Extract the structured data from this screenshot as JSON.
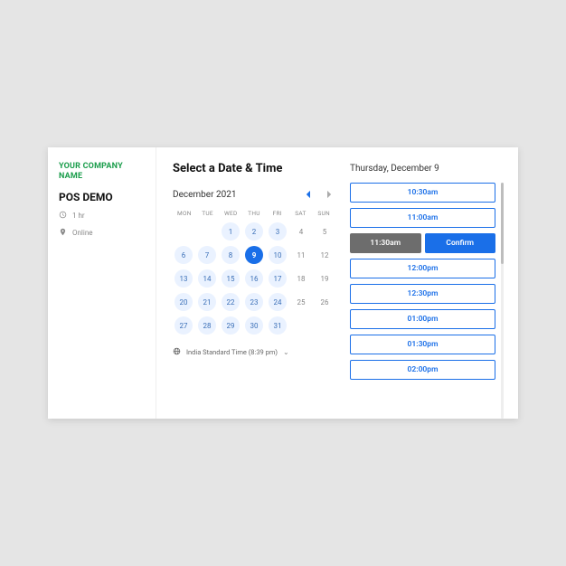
{
  "sidebar": {
    "company_name": "YOUR COMPANY NAME",
    "demo_title": "POS DEMO",
    "duration": "1 hr",
    "location": "Online"
  },
  "main": {
    "title": "Select a Date & Time",
    "month_label": "December 2021",
    "timezone": "India Standard Time (8:39 pm)",
    "selected_date_label": "Thursday, December 9"
  },
  "dow": [
    "MON",
    "TUE",
    "WED",
    "THU",
    "FRI",
    "SAT",
    "SUN"
  ],
  "days": [
    {
      "n": "",
      "t": "empty"
    },
    {
      "n": "",
      "t": "empty"
    },
    {
      "n": "1",
      "t": "avail"
    },
    {
      "n": "2",
      "t": "avail"
    },
    {
      "n": "3",
      "t": "avail"
    },
    {
      "n": "4",
      "t": "plain"
    },
    {
      "n": "5",
      "t": "plain"
    },
    {
      "n": "6",
      "t": "avail"
    },
    {
      "n": "7",
      "t": "avail"
    },
    {
      "n": "8",
      "t": "avail"
    },
    {
      "n": "9",
      "t": "selected"
    },
    {
      "n": "10",
      "t": "avail"
    },
    {
      "n": "11",
      "t": "plain"
    },
    {
      "n": "12",
      "t": "plain"
    },
    {
      "n": "13",
      "t": "avail"
    },
    {
      "n": "14",
      "t": "avail"
    },
    {
      "n": "15",
      "t": "avail"
    },
    {
      "n": "16",
      "t": "avail"
    },
    {
      "n": "17",
      "t": "avail"
    },
    {
      "n": "18",
      "t": "plain"
    },
    {
      "n": "19",
      "t": "plain"
    },
    {
      "n": "20",
      "t": "avail"
    },
    {
      "n": "21",
      "t": "avail"
    },
    {
      "n": "22",
      "t": "avail"
    },
    {
      "n": "23",
      "t": "avail"
    },
    {
      "n": "24",
      "t": "avail"
    },
    {
      "n": "25",
      "t": "plain"
    },
    {
      "n": "26",
      "t": "plain"
    },
    {
      "n": "27",
      "t": "avail"
    },
    {
      "n": "28",
      "t": "avail"
    },
    {
      "n": "29",
      "t": "avail"
    },
    {
      "n": "30",
      "t": "avail"
    },
    {
      "n": "31",
      "t": "avail"
    },
    {
      "n": "",
      "t": "empty"
    },
    {
      "n": "",
      "t": "empty"
    }
  ],
  "slots": [
    {
      "time": "10:30am",
      "state": "open"
    },
    {
      "time": "11:00am",
      "state": "open"
    },
    {
      "time": "11:30am",
      "state": "selected"
    },
    {
      "time": "12:00pm",
      "state": "open"
    },
    {
      "time": "12:30pm",
      "state": "open"
    },
    {
      "time": "01:00pm",
      "state": "open"
    },
    {
      "time": "01:30pm",
      "state": "open"
    },
    {
      "time": "02:00pm",
      "state": "open"
    }
  ],
  "confirm_label": "Confirm"
}
